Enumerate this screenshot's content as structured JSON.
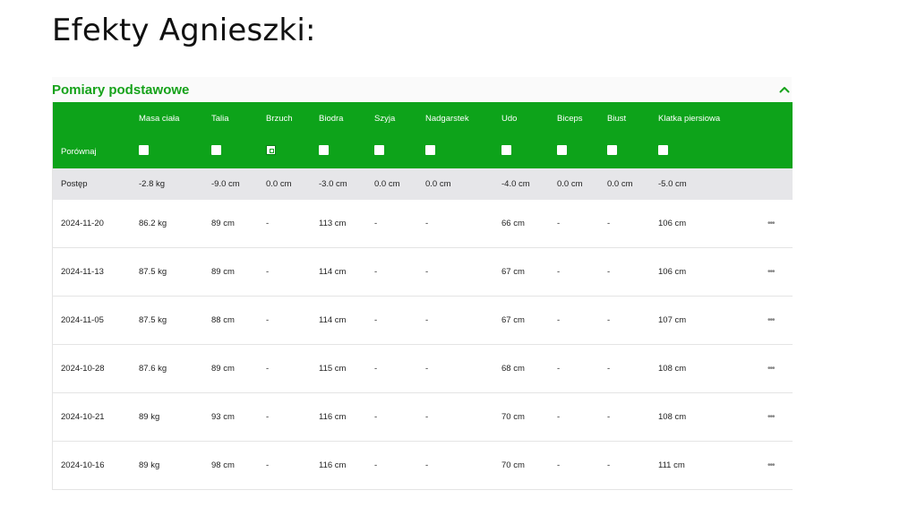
{
  "slide_title": "Efekty Agnieszki:",
  "panel": {
    "title": "Pomiary podstawowe",
    "collapse_icon": "chevron-up-icon",
    "accent": "#0da31a"
  },
  "columns": [
    "",
    "Masa ciała",
    "Talia",
    "Brzuch",
    "Biodra",
    "Szyja",
    "Nadgarstek",
    "Udo",
    "Biceps",
    "Biust",
    "Klatka piersiowa",
    ""
  ],
  "compare": {
    "label": "Porównaj",
    "checked": [
      false,
      false,
      true,
      false,
      false,
      false,
      false,
      false,
      false,
      false
    ]
  },
  "progress": {
    "label": "Postęp",
    "values": [
      "-2.8 kg",
      "-9.0 cm",
      "0.0 cm",
      "-3.0 cm",
      "0.0 cm",
      "0.0 cm",
      "-4.0 cm",
      "0.0 cm",
      "0.0 cm",
      "-5.0 cm"
    ]
  },
  "rows": [
    {
      "date": "2024-11-20",
      "values": [
        "86.2 kg",
        "89 cm",
        "-",
        "113 cm",
        "-",
        "-",
        "66 cm",
        "-",
        "-",
        "106 cm"
      ],
      "more": "•••"
    },
    {
      "date": "2024-11-13",
      "values": [
        "87.5 kg",
        "89 cm",
        "-",
        "114 cm",
        "-",
        "-",
        "67 cm",
        "-",
        "-",
        "106 cm"
      ],
      "more": "•••"
    },
    {
      "date": "2024-11-05",
      "values": [
        "87.5 kg",
        "88 cm",
        "-",
        "114 cm",
        "-",
        "-",
        "67 cm",
        "-",
        "-",
        "107 cm"
      ],
      "more": "•••"
    },
    {
      "date": "2024-10-28",
      "values": [
        "87.6 kg",
        "89 cm",
        "-",
        "115 cm",
        "-",
        "-",
        "68 cm",
        "-",
        "-",
        "108 cm"
      ],
      "more": "•••"
    },
    {
      "date": "2024-10-21",
      "values": [
        "89 kg",
        "93 cm",
        "-",
        "116 cm",
        "-",
        "-",
        "70 cm",
        "-",
        "-",
        "108 cm"
      ],
      "more": "•••"
    },
    {
      "date": "2024-10-16",
      "values": [
        "89 kg",
        "98 cm",
        "-",
        "116 cm",
        "-",
        "-",
        "70 cm",
        "-",
        "-",
        "111 cm"
      ],
      "more": "•••"
    }
  ]
}
